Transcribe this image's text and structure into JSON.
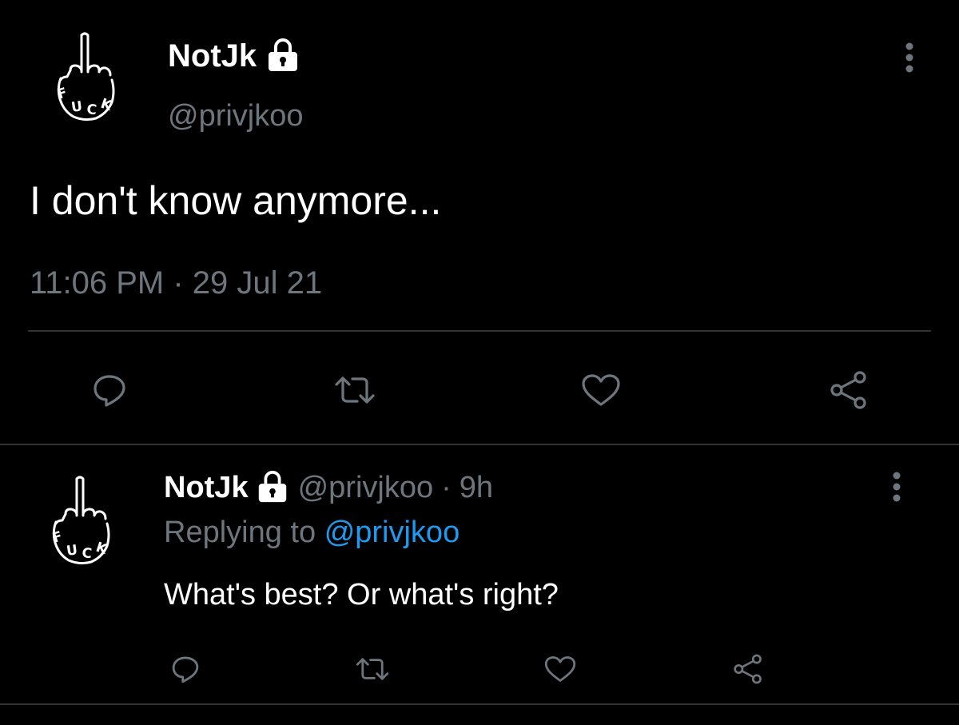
{
  "main_tweet": {
    "author_name": "NotJk",
    "handle": "@privjkoo",
    "text": "I don't know anymore...",
    "timestamp": "11:06 PM · 29 Jul 21"
  },
  "reply": {
    "author_name": "NotJk",
    "handle": "@privjkoo",
    "separator": "·",
    "age": "9h",
    "replying_prefix": "Replying to",
    "replying_handle": "@privjkoo",
    "text": "What's best? Or what's right?"
  },
  "colors": {
    "background": "#000000",
    "text": "#ffffff",
    "secondary": "#6e767d",
    "link": "#1d9bf0",
    "divider": "#2f3336"
  }
}
